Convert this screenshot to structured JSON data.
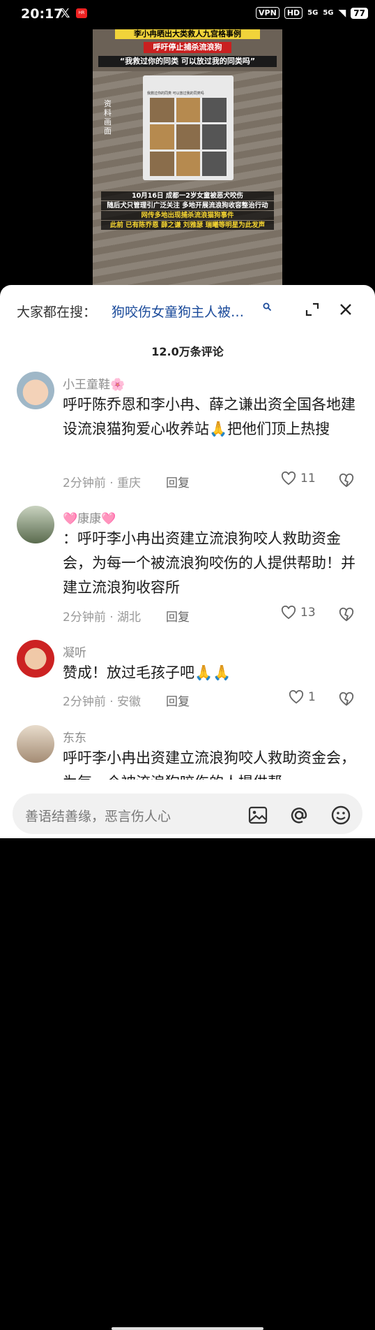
{
  "status_bar": {
    "time": "20:17",
    "x_glyph": "𝕏",
    "app_badge": "HR",
    "vpn": "VPN",
    "hd": "HD",
    "sig1": "5G",
    "sig2": "5G",
    "battery": "77"
  },
  "video": {
    "banner_title": "李小冉晒出大类救人九宫格事例",
    "banner_red": "呼吁停止捕杀流浪狗",
    "banner_quote": "“我救过你的同类 可以放过我的同类吗”",
    "side_label": "资料画面",
    "post_text": "我救过你的同类 可以放过我的同类吗",
    "caption_lines": [
      "10月16日 成都一2岁女童被恶犬咬伤",
      "随后犬只管理引广泛关注 多地开展流浪狗收容整治行动",
      "网传多地出现捕杀流浪猫狗事件",
      "此前 已有陈乔恩 薛之谦 刘雅瑟 瑞曦等明星为此发声"
    ]
  },
  "search": {
    "prefix": "大家都在搜：",
    "query": "狗咬伤女童狗主人被…"
  },
  "comment_count": "12.0万条评论",
  "comments": [
    {
      "name": "小王童鞋🌸",
      "text": "呼吁陈乔恩和李小冉、薛之谦出资全国各地建设流浪猫狗爱心收养站🙏把他们顶上热搜",
      "meta": "2分钟前 · 重庆",
      "reply": "回复",
      "likes": "11"
    },
    {
      "name": "🩷康康🩷",
      "text": "：呼吁李小冉出资建立流浪狗咬人救助资金会，为每一个被流浪狗咬伤的人提供帮助！并建立流浪狗收容所",
      "meta": "2分钟前 · 湖北",
      "reply": "回复",
      "likes": "13"
    },
    {
      "name": "凝听",
      "text": "赞成！放过毛孩子吧🙏🙏",
      "meta": "2分钟前 · 安徽",
      "reply": "回复",
      "likes": "1"
    },
    {
      "name": "东东",
      "text": "呼吁李小冉出资建立流浪狗咬人救助资金会，为每一个被流浪狗咬伤的人提供帮",
      "meta": "",
      "reply": "",
      "likes": ""
    }
  ],
  "input": {
    "placeholder": "善语结善缘，恶言伤人心"
  },
  "icons": [
    "search-icon",
    "expand-icon",
    "close-icon",
    "heart-icon",
    "dislike-icon",
    "image-icon",
    "at-icon",
    "emoji-icon"
  ],
  "colors": {
    "link": "#1a4a9a",
    "banner_yellow": "#f1d33a",
    "banner_red": "#c92020"
  }
}
